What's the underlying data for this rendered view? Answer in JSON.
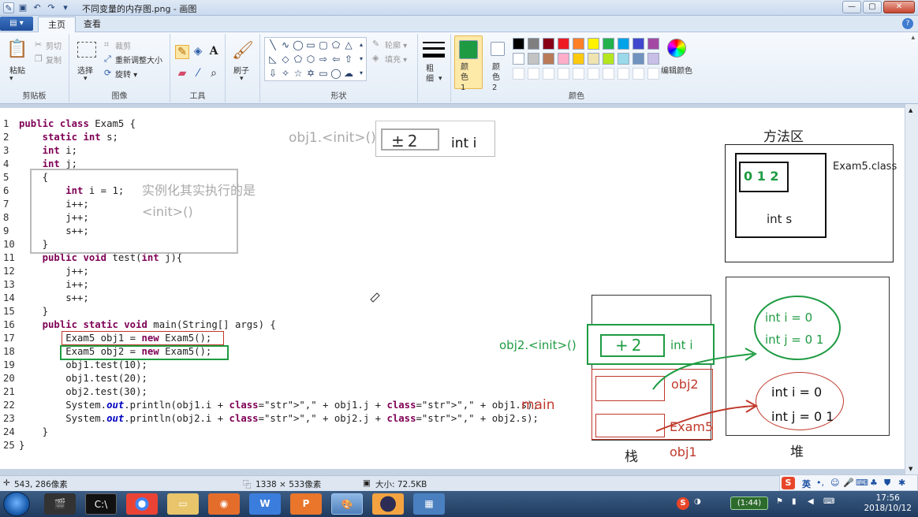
{
  "window": {
    "title": "不同变量的内存图.png - 画图",
    "controls": {
      "minimize": "—",
      "maximize": "▢",
      "close": "✕"
    }
  },
  "tabs": {
    "file": "▤ ▾",
    "home": "主页",
    "view": "查看"
  },
  "ribbon": {
    "clipboard": {
      "label": "剪贴板",
      "paste": "粘贴",
      "cut": "剪切",
      "copy": "复制"
    },
    "image": {
      "label": "图像",
      "select": "选择",
      "crop": "裁剪",
      "resize": "重新调整大小",
      "rotate": "旋转 ▾"
    },
    "tools": {
      "label": "工具"
    },
    "brush": {
      "label": "刷子"
    },
    "shapes": {
      "label": "形状",
      "outline": "轮廓 ▾",
      "fill": "填充 ▾"
    },
    "size": {
      "label": "粗细"
    },
    "colors": {
      "label": "颜色",
      "color1_label": "颜色 1",
      "color2_label": "颜色 2",
      "edit_label": "编辑颜色",
      "color1": "#1e9b42",
      "color2": "#ffffff",
      "palette_row1": [
        "#000000",
        "#7f7f7f",
        "#880015",
        "#ed1c24",
        "#ff7f27",
        "#fff200",
        "#22b14c",
        "#00a2e8",
        "#3f48cc",
        "#a349a4"
      ],
      "palette_row2": [
        "#ffffff",
        "#c3c3c3",
        "#b97a57",
        "#ffaec9",
        "#ffc90e",
        "#efe4b0",
        "#b5e61d",
        "#99d9ea",
        "#7092be",
        "#c8bfe7"
      ]
    }
  },
  "code": [
    {
      "n": "1",
      "t": "public class Exam5 {"
    },
    {
      "n": "2",
      "t": "    static int s;"
    },
    {
      "n": "3",
      "t": "    int i;"
    },
    {
      "n": "4",
      "t": "    int j;"
    },
    {
      "n": "5",
      "t": "    {"
    },
    {
      "n": "6",
      "t": "        int i = 1;"
    },
    {
      "n": "7",
      "t": "        i++;"
    },
    {
      "n": "8",
      "t": "        j++;"
    },
    {
      "n": "9",
      "t": "        s++;"
    },
    {
      "n": "10",
      "t": "    }"
    },
    {
      "n": "11",
      "t": "    public void test(int j){"
    },
    {
      "n": "12",
      "t": "        j++;"
    },
    {
      "n": "13",
      "t": "        i++;"
    },
    {
      "n": "14",
      "t": "        s++;"
    },
    {
      "n": "15",
      "t": "    }"
    },
    {
      "n": "16",
      "t": "    public static void main(String[] args) {"
    },
    {
      "n": "17",
      "t": "        Exam5 obj1 = new Exam5();"
    },
    {
      "n": "18",
      "t": "        Exam5 obj2 = new Exam5();"
    },
    {
      "n": "19",
      "t": "        obj1.test(10);"
    },
    {
      "n": "20",
      "t": "        obj1.test(20);"
    },
    {
      "n": "21",
      "t": "        obj2.test(30);"
    },
    {
      "n": "22",
      "t": "        System.out.println(obj1.i + \",\" + obj1.j + \",\" + obj1.s);"
    },
    {
      "n": "23",
      "t": "        System.out.println(obj2.i + \",\" + obj2.j + \",\" + obj2.s);"
    },
    {
      "n": "24",
      "t": "    }"
    },
    {
      "n": "25",
      "t": "}"
    }
  ],
  "annotations": {
    "init_note_1": "实例化其实执行的是",
    "init_note_2": "<init>()",
    "obj1_init": "obj1.<init>()",
    "obj1_frame_value": "±2",
    "obj1_frame_var": "int i",
    "method_area_title": "方法区",
    "method_area_class": "Exam5.class",
    "static_value": "0 1 2",
    "static_var": "int s",
    "obj2_init": "obj2.<init>()",
    "obj2_frame_value": "+2",
    "obj2_frame_var": "int i",
    "main_label": "main",
    "stack_obj2": "obj2",
    "stack_exam5": "Exam5",
    "stack_obj1": "obj1",
    "stack_label": "栈",
    "heap_label": "堆",
    "heap_obj2_i": "int i = 0",
    "heap_obj2_j": "int j = 0 1",
    "heap_obj1_i": "int i = 0",
    "heap_obj1_j": "int j = 0 1"
  },
  "status": {
    "cursor": "543, 286像素",
    "dimensions": "1338 × 533像素",
    "size": "大小: 72.5KB"
  },
  "taskbar": {
    "battery": "(1:44)",
    "time": "17:56",
    "date": "2018/10/12",
    "ime": "英"
  }
}
